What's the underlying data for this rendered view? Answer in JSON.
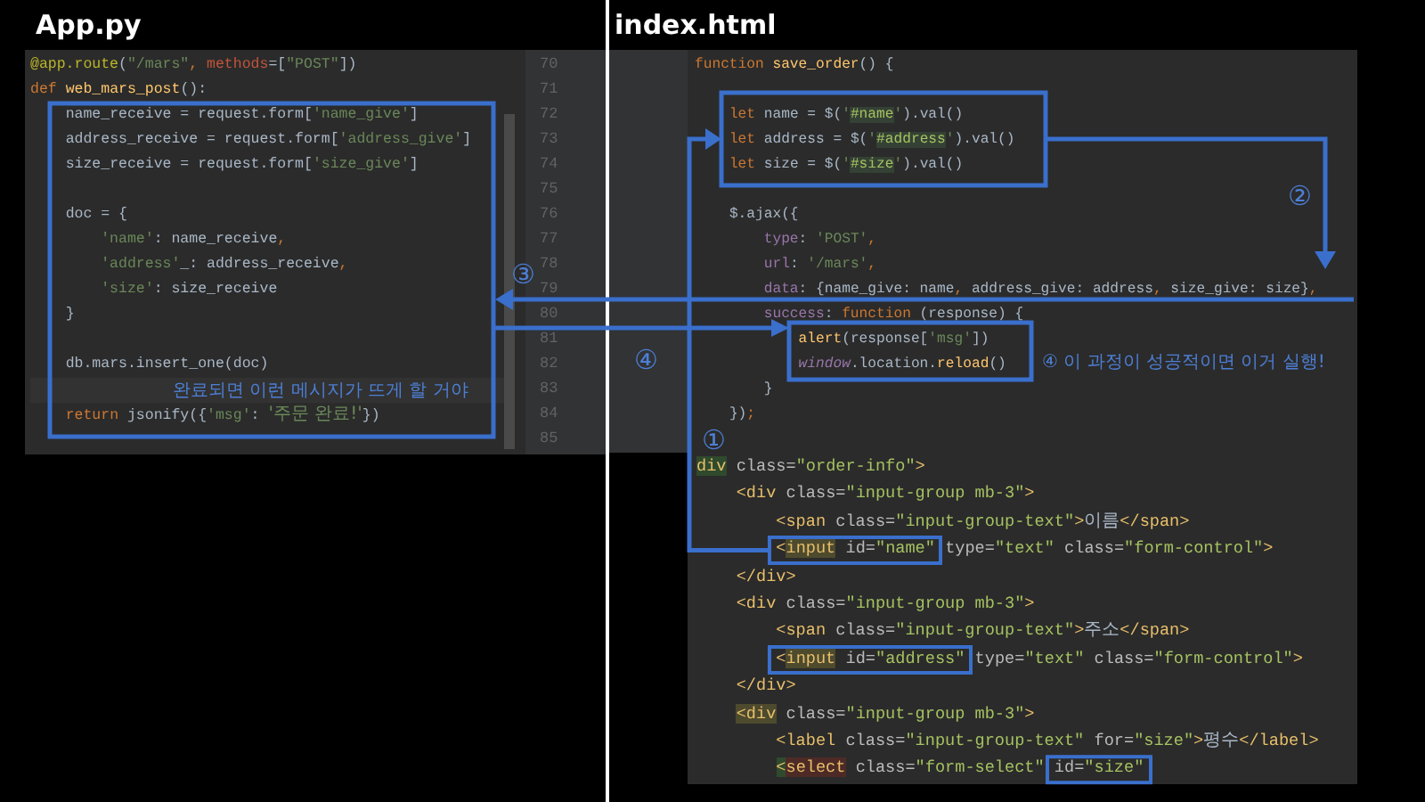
{
  "left_title": "App.py",
  "right_title": "index.html",
  "python_editor": {
    "line_numbers": [
      "70",
      "71",
      "72",
      "73",
      "74",
      "75",
      "76",
      "77",
      "78",
      "79",
      "80",
      "81",
      "82",
      "83",
      "84",
      "85"
    ],
    "lines": [
      {
        "kind": "code",
        "segments": [
          {
            "text": "@app.route",
            "kind": "decor"
          },
          {
            "text": "(",
            "kind": "plain"
          },
          {
            "text": "\"/mars\"",
            "kind": "str"
          },
          {
            "text": ", ",
            "kind": "kw"
          },
          {
            "text": "methods",
            "kind": "param"
          },
          {
            "text": "=",
            "kind": "plain"
          },
          {
            "text": "[",
            "kind": "plain"
          },
          {
            "text": "\"POST\"",
            "kind": "str"
          },
          {
            "text": "])",
            "kind": "plain"
          }
        ]
      },
      {
        "kind": "code",
        "segments": [
          {
            "text": "def ",
            "kind": "kw"
          },
          {
            "text": "web_mars_post",
            "kind": "fn"
          },
          {
            "text": "():",
            "kind": "plain"
          }
        ]
      },
      {
        "kind": "code",
        "segments": [
          {
            "text": "    name_receive = request.form[",
            "kind": "plain"
          },
          {
            "text": "'name_give'",
            "kind": "str"
          },
          {
            "text": "]",
            "kind": "plain"
          }
        ]
      },
      {
        "kind": "code",
        "segments": [
          {
            "text": "    address_receive = request.form[",
            "kind": "plain"
          },
          {
            "text": "'address_give'",
            "kind": "str"
          },
          {
            "text": "]",
            "kind": "plain"
          }
        ]
      },
      {
        "kind": "code",
        "segments": [
          {
            "text": "    size_receive = request.form[",
            "kind": "plain"
          },
          {
            "text": "'size_give'",
            "kind": "str"
          },
          {
            "text": "]",
            "kind": "plain"
          }
        ]
      },
      {
        "kind": "blank"
      },
      {
        "kind": "code",
        "segments": [
          {
            "text": "    doc = {",
            "kind": "plain"
          }
        ]
      },
      {
        "kind": "code",
        "segments": [
          {
            "text": "        'name'",
            "kind": "str"
          },
          {
            "text": ": name_receive",
            "kind": "plain"
          },
          {
            "text": ",",
            "kind": "kw"
          }
        ]
      },
      {
        "kind": "code",
        "segments": [
          {
            "text": "        'address'",
            "kind": "str"
          },
          {
            "text": "_: address_receive",
            "kind": "plain"
          },
          {
            "text": ",",
            "kind": "kw"
          }
        ]
      },
      {
        "kind": "code",
        "segments": [
          {
            "text": "        'size'",
            "kind": "str"
          },
          {
            "text": ": size_receive",
            "kind": "plain"
          }
        ]
      },
      {
        "kind": "code",
        "segments": [
          {
            "text": "    }",
            "kind": "plain"
          }
        ]
      },
      {
        "kind": "blank"
      },
      {
        "kind": "code",
        "segments": [
          {
            "text": "    db.mars.insert_one(doc)",
            "kind": "plain"
          }
        ]
      },
      {
        "kind": "note",
        "text": "완료되면 이런 메시지가 뜨게 할 거야"
      },
      {
        "kind": "code",
        "segments": [
          {
            "text": "    return ",
            "kind": "kw"
          },
          {
            "text": "jsonify({",
            "kind": "plain"
          },
          {
            "text": "'msg'",
            "kind": "str"
          },
          {
            "text": ": ",
            "kind": "plain"
          },
          {
            "text": "'주문 완료!'",
            "kind": "str-ko"
          },
          {
            "text": "})",
            "kind": "plain"
          }
        ]
      }
    ]
  },
  "js_editor": {
    "lines": [
      {
        "segments": [
          {
            "text": "function ",
            "kind": "kw"
          },
          {
            "text": "save_order",
            "kind": "fn"
          },
          {
            "text": "() {",
            "kind": "plain"
          }
        ]
      },
      {
        "kind": "blank"
      },
      {
        "segments": [
          {
            "text": "    let ",
            "kind": "kw"
          },
          {
            "text": "name = $(",
            "kind": "plain"
          },
          {
            "text": "'",
            "kind": "str"
          },
          {
            "text": "#name",
            "kind": "hl"
          },
          {
            "text": "'",
            "kind": "str"
          },
          {
            "text": ").val()",
            "kind": "plain"
          }
        ]
      },
      {
        "segments": [
          {
            "text": "    let ",
            "kind": "kw"
          },
          {
            "text": "address = $(",
            "kind": "plain"
          },
          {
            "text": "'",
            "kind": "str"
          },
          {
            "text": "#address",
            "kind": "hl"
          },
          {
            "text": "'",
            "kind": "str"
          },
          {
            "text": ").val()",
            "kind": "plain"
          }
        ]
      },
      {
        "segments": [
          {
            "text": "    let ",
            "kind": "kw"
          },
          {
            "text": "size = $(",
            "kind": "plain"
          },
          {
            "text": "'",
            "kind": "str"
          },
          {
            "text": "#size",
            "kind": "hl"
          },
          {
            "text": "'",
            "kind": "str"
          },
          {
            "text": ").val()",
            "kind": "plain"
          }
        ]
      },
      {
        "kind": "blank"
      },
      {
        "segments": [
          {
            "text": "    $.ajax({",
            "kind": "plain"
          }
        ]
      },
      {
        "segments": [
          {
            "text": "        type",
            "kind": "prop"
          },
          {
            "text": ": ",
            "kind": "plain"
          },
          {
            "text": "'POST'",
            "kind": "str"
          },
          {
            "text": ",",
            "kind": "kw"
          }
        ]
      },
      {
        "segments": [
          {
            "text": "        url",
            "kind": "prop"
          },
          {
            "text": ": ",
            "kind": "plain"
          },
          {
            "text": "'/mars'",
            "kind": "str"
          },
          {
            "text": ",",
            "kind": "kw"
          }
        ]
      },
      {
        "segments": [
          {
            "text": "        data",
            "kind": "prop"
          },
          {
            "text": ": {name_give: name",
            "kind": "plain"
          },
          {
            "text": ",",
            "kind": "kw"
          },
          {
            "text": " address_give: address",
            "kind": "plain"
          },
          {
            "text": ",",
            "kind": "kw"
          },
          {
            "text": " size_give: size}",
            "kind": "plain"
          },
          {
            "text": ",",
            "kind": "kw"
          }
        ]
      },
      {
        "segments": [
          {
            "text": "        success",
            "kind": "prop"
          },
          {
            "text": ": ",
            "kind": "plain"
          },
          {
            "text": "function ",
            "kind": "kw"
          },
          {
            "text": "(response) {",
            "kind": "plain"
          }
        ]
      },
      {
        "segments": [
          {
            "text": "            alert",
            "kind": "fn"
          },
          {
            "text": "(response[",
            "kind": "plain"
          },
          {
            "text": "'msg'",
            "kind": "str"
          },
          {
            "text": "])",
            "kind": "plain"
          }
        ]
      },
      {
        "segments": [
          {
            "text": "            window",
            "kind": "global"
          },
          {
            "text": ".location.",
            "kind": "plain"
          },
          {
            "text": "reload",
            "kind": "fn"
          },
          {
            "text": "()",
            "kind": "plain"
          }
        ]
      },
      {
        "segments": [
          {
            "text": "        }",
            "kind": "plain"
          }
        ]
      },
      {
        "segments": [
          {
            "text": "    })",
            "kind": "plain"
          },
          {
            "text": ";",
            "kind": "kw"
          }
        ]
      }
    ]
  },
  "html_editor": {
    "lines": [
      {
        "segments": [
          {
            "text": "div",
            "kind": "tag-green"
          },
          {
            "text": " class=",
            "kind": "attr"
          },
          {
            "text": "\"order-info\"",
            "kind": "val"
          },
          {
            "text": ">",
            "kind": "tag"
          }
        ]
      },
      {
        "segments": [
          {
            "text": "    <div",
            "kind": "tag"
          },
          {
            "text": " class=",
            "kind": "attr"
          },
          {
            "text": "\"input-group mb-3\"",
            "kind": "val"
          },
          {
            "text": ">",
            "kind": "tag"
          }
        ]
      },
      {
        "segments": [
          {
            "text": "        <span",
            "kind": "tag"
          },
          {
            "text": " class=",
            "kind": "attr"
          },
          {
            "text": "\"input-group-text\"",
            "kind": "val"
          },
          {
            "text": ">",
            "kind": "tag"
          },
          {
            "text": "이름",
            "kind": "ko"
          },
          {
            "text": "</span>",
            "kind": "tag"
          }
        ]
      },
      {
        "segments": [
          {
            "text": "        <",
            "kind": "tag"
          },
          {
            "text": "input",
            "kind": "tag-yellow"
          },
          {
            "text": " id=",
            "kind": "attr"
          },
          {
            "text": "\"name\"",
            "kind": "val"
          },
          {
            "text": " type=",
            "kind": "attr"
          },
          {
            "text": "\"text\"",
            "kind": "val"
          },
          {
            "text": " class=",
            "kind": "attr"
          },
          {
            "text": "\"form-control\"",
            "kind": "val"
          },
          {
            "text": ">",
            "kind": "tag"
          }
        ]
      },
      {
        "segments": [
          {
            "text": "    </div>",
            "kind": "tag"
          }
        ]
      },
      {
        "segments": [
          {
            "text": "    <div",
            "kind": "tag"
          },
          {
            "text": " class=",
            "kind": "attr"
          },
          {
            "text": "\"input-group mb-3\"",
            "kind": "val"
          },
          {
            "text": ">",
            "kind": "tag"
          }
        ]
      },
      {
        "segments": [
          {
            "text": "        <span",
            "kind": "tag"
          },
          {
            "text": " class=",
            "kind": "attr"
          },
          {
            "text": "\"input-group-text\"",
            "kind": "val"
          },
          {
            "text": ">",
            "kind": "tag"
          },
          {
            "text": "주소",
            "kind": "ko"
          },
          {
            "text": "</span>",
            "kind": "tag"
          }
        ]
      },
      {
        "segments": [
          {
            "text": "        <",
            "kind": "tag"
          },
          {
            "text": "input",
            "kind": "tag-yellow"
          },
          {
            "text": " id=",
            "kind": "attr"
          },
          {
            "text": "\"address\"",
            "kind": "val"
          },
          {
            "text": " type=",
            "kind": "attr"
          },
          {
            "text": "\"text\"",
            "kind": "val"
          },
          {
            "text": " class=",
            "kind": "attr"
          },
          {
            "text": "\"form-control\"",
            "kind": "val"
          },
          {
            "text": ">",
            "kind": "tag"
          }
        ]
      },
      {
        "segments": [
          {
            "text": "    </div>",
            "kind": "tag"
          }
        ]
      },
      {
        "segments": [
          {
            "text": "    <div",
            "kind": "tag-yellow"
          },
          {
            "text": " class=",
            "kind": "attr"
          },
          {
            "text": "\"input-group mb-3\"",
            "kind": "val"
          },
          {
            "text": ">",
            "kind": "tag"
          }
        ]
      },
      {
        "segments": [
          {
            "text": "        <label",
            "kind": "tag"
          },
          {
            "text": " class=",
            "kind": "attr"
          },
          {
            "text": "\"input-group-text\"",
            "kind": "val"
          },
          {
            "text": " for=",
            "kind": "attr"
          },
          {
            "text": "\"size\"",
            "kind": "val"
          },
          {
            "text": ">",
            "kind": "tag"
          },
          {
            "text": "평수",
            "kind": "ko"
          },
          {
            "text": "</label>",
            "kind": "tag"
          }
        ]
      },
      {
        "segments": [
          {
            "text": "        <",
            "kind": "tag-green"
          },
          {
            "text": "select",
            "kind": "tag-red"
          },
          {
            "text": " class=",
            "kind": "attr"
          },
          {
            "text": "\"form-select\"",
            "kind": "val"
          },
          {
            "text": " id=",
            "kind": "attr"
          },
          {
            "text": "\"size\"",
            "kind": "val"
          }
        ]
      }
    ]
  },
  "annotations": [
    {
      "kind": "circled-number",
      "text": "③"
    },
    {
      "kind": "circled-number",
      "text": "④"
    },
    {
      "kind": "circled-number",
      "text": "②"
    },
    {
      "kind": "circled-number",
      "text": "①"
    },
    {
      "kind": "note",
      "text": "④ 이 과정이 성공적이면 이거 실행!"
    }
  ]
}
